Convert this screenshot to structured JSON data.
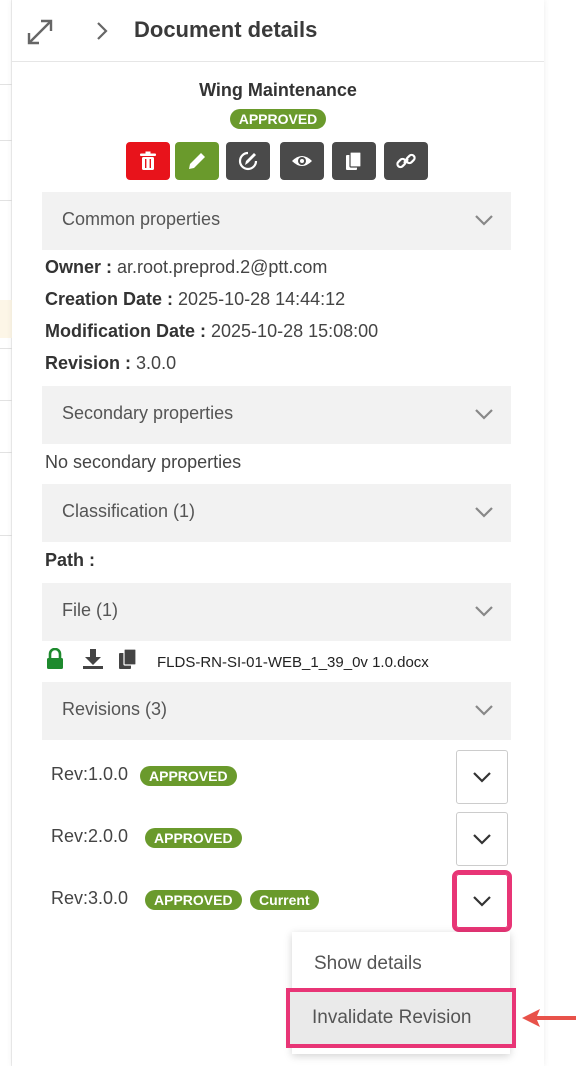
{
  "header": {
    "title": "Document details"
  },
  "document": {
    "title": "Wing Maintenance",
    "status": "APPROVED"
  },
  "sections": {
    "common": "Common properties",
    "secondary": "Secondary properties",
    "classification": "Classification (1)",
    "file": "File (1)",
    "revisions": "Revisions (3)"
  },
  "properties": {
    "owner_label": "Owner :",
    "owner": "ar.root.preprod.2@ptt.com",
    "creation_label": "Creation Date :",
    "creation": "2025-10-28 14:44:12",
    "modification_label": "Modification Date :",
    "modification": "2025-10-28 15:08:00",
    "revision_label": "Revision :",
    "revision": "3.0.0"
  },
  "secondary_empty": "No secondary properties",
  "path_label": "Path :",
  "file": {
    "name": "FLDS-RN-SI-01-WEB_1_39_0v 1.0.docx"
  },
  "revisions": [
    {
      "label": "Rev:1.0.0",
      "status": "APPROVED"
    },
    {
      "label": "Rev:2.0.0",
      "status": "APPROVED"
    },
    {
      "label": "Rev:3.0.0",
      "status": "APPROVED",
      "current": "Current"
    }
  ],
  "menu": {
    "show_details": "Show details",
    "invalidate": "Invalidate Revision"
  },
  "colors": {
    "approved": "#6a9a2c",
    "delete": "#e8131b",
    "edit": "#6a9a2c",
    "highlight": "#e83576",
    "arrow": "#e8524a"
  },
  "icons": [
    "expand-icon",
    "chevron-right-icon",
    "trash-icon",
    "pencil-icon",
    "sign-icon",
    "eye-icon",
    "copy-icon",
    "link-icon",
    "chevron-down-icon",
    "lock-icon",
    "download-icon",
    "copy-icon"
  ]
}
